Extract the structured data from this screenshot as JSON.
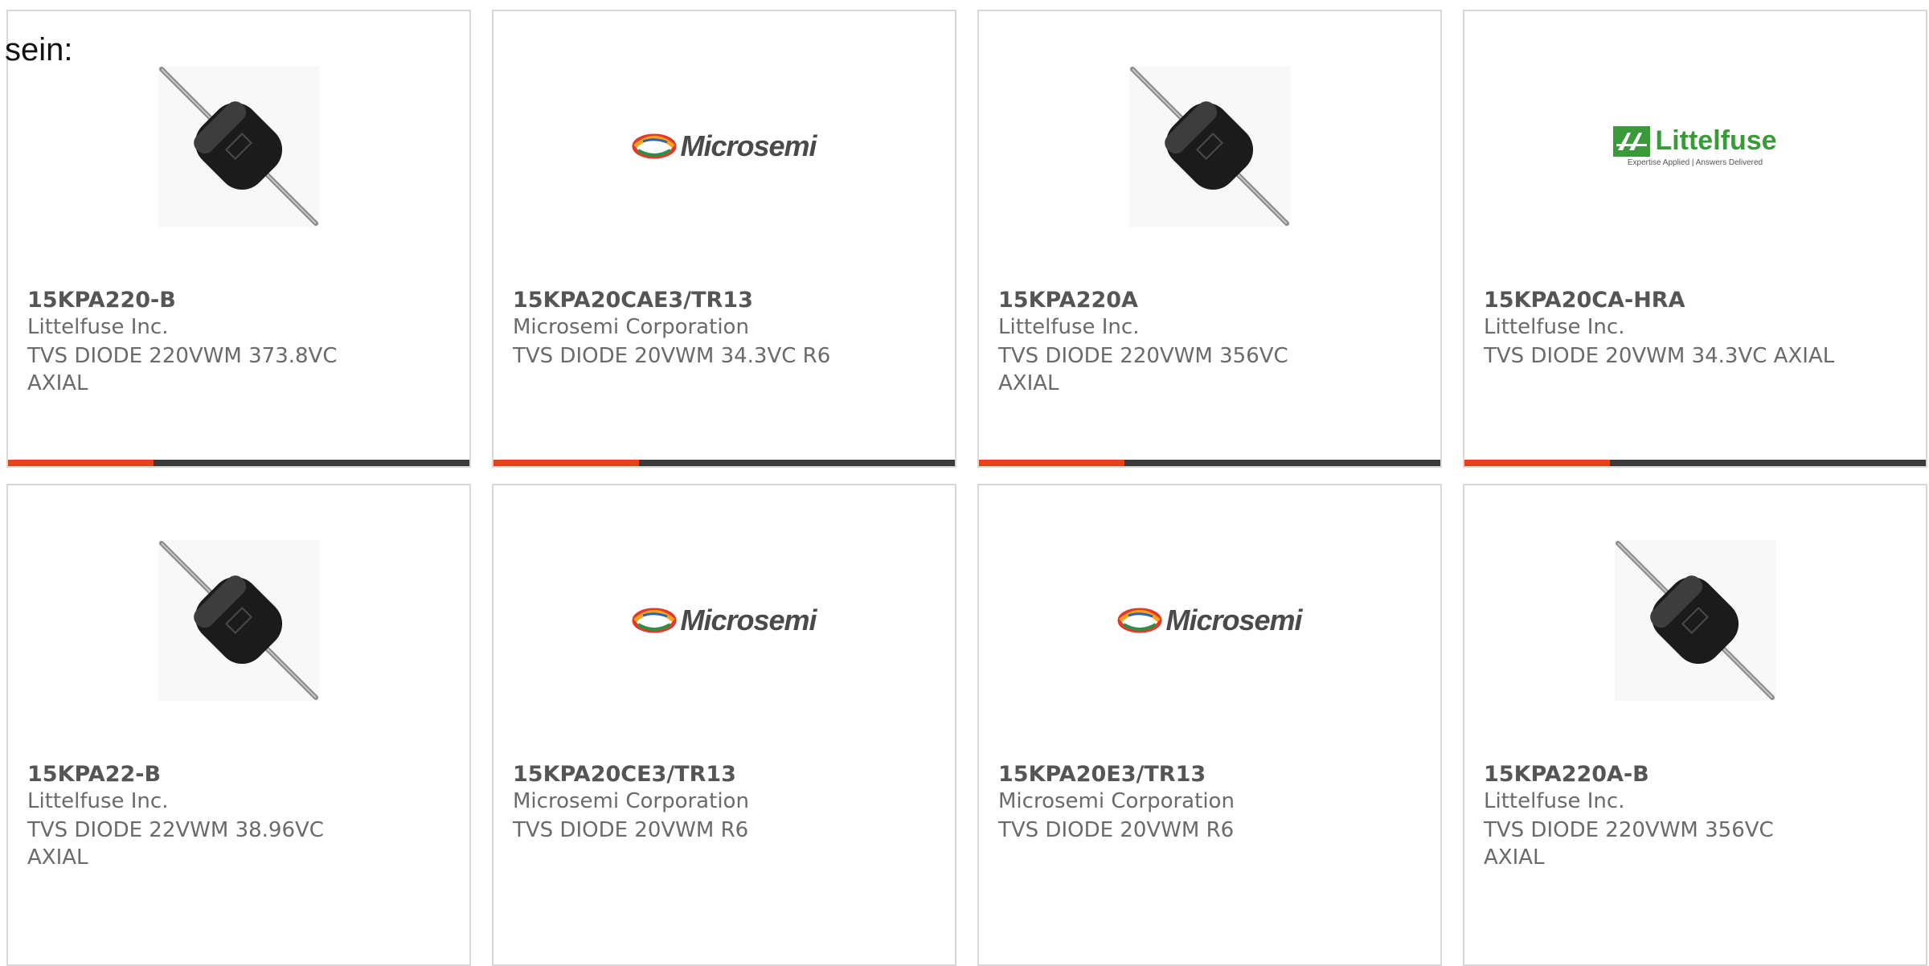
{
  "intro_text": "sein:",
  "colors": {
    "accent": "#e8421b",
    "bar": "#3a3a3a",
    "border": "#d8d8d8",
    "littelfuse_green": "#3a9a3a"
  },
  "products": [
    {
      "title": "15KPA220-B",
      "manufacturer": "Littelfuse Inc.",
      "description": "TVS DIODE 220VWM 373.8VC AXIAL",
      "image": "diode-photo"
    },
    {
      "title": "15KPA20CAE3/TR13",
      "manufacturer": "Microsemi Corporation",
      "description": "TVS DIODE 20VWM 34.3VC R6",
      "image": "microsemi-logo"
    },
    {
      "title": "15KPA220A",
      "manufacturer": "Littelfuse Inc.",
      "description": "TVS DIODE 220VWM 356VC AXIAL",
      "image": "diode-photo"
    },
    {
      "title": "15KPA20CA-HRA",
      "manufacturer": "Littelfuse Inc.",
      "description": "TVS DIODE 20VWM 34.3VC AXIAL",
      "image": "littelfuse-logo"
    },
    {
      "title": "15KPA22-B",
      "manufacturer": "Littelfuse Inc.",
      "description": "TVS DIODE 22VWM 38.96VC AXIAL",
      "image": "diode-photo"
    },
    {
      "title": "15KPA20CE3/TR13",
      "manufacturer": "Microsemi Corporation",
      "description": "TVS DIODE 20VWM R6",
      "image": "microsemi-logo"
    },
    {
      "title": "15KPA20E3/TR13",
      "manufacturer": "Microsemi Corporation",
      "description": "TVS DIODE 20VWM R6",
      "image": "microsemi-logo"
    },
    {
      "title": "15KPA220A-B",
      "manufacturer": "Littelfuse Inc.",
      "description": "TVS DIODE 220VWM 356VC AXIAL",
      "image": "diode-photo"
    }
  ],
  "logos": {
    "microsemi": "Microsemi",
    "littelfuse": "Littelfuse",
    "littelfuse_tagline": "Expertise Applied | Answers Delivered"
  }
}
